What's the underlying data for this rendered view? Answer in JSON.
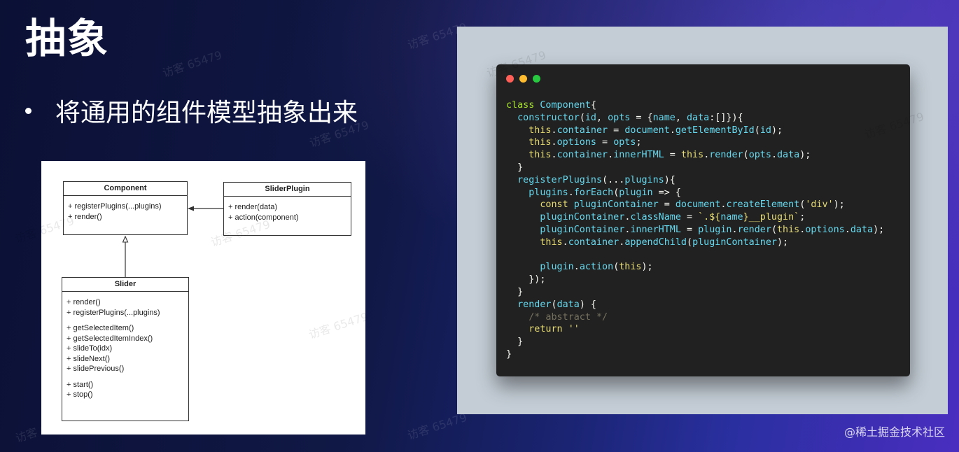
{
  "slide": {
    "title": "抽象",
    "bullet": "将通用的组件模型抽象出来",
    "watermark": "访客 65479",
    "credit": "@稀土掘金技术社区"
  },
  "uml": {
    "component": {
      "name": "Component",
      "methods": [
        "+ registerPlugins(...plugins)",
        "+ render()"
      ]
    },
    "slider_plugin": {
      "name": "SliderPlugin",
      "methods": [
        "+ render(data)",
        "+ action(component)"
      ]
    },
    "slider": {
      "name": "Slider",
      "groups": [
        [
          "+ render()",
          "+ registerPlugins(...plugins)"
        ],
        [
          "+ getSelectedItem()",
          "+ getSelectedItemIndex()",
          "+ slideTo(idx)",
          "+ slideNext()",
          "+ slidePrevious()"
        ],
        [
          "+ start()",
          "+ stop()"
        ]
      ]
    }
  },
  "code_window": {
    "dot_colors": [
      "#ff5f57",
      "#febc2e",
      "#28c840"
    ],
    "colors": {
      "keyword": "#a6e22e",
      "name": "#66d9ef",
      "this": "#e6db74",
      "ident": "#f8f8f2",
      "string": "#e6db74",
      "comment": "#75715e",
      "plain": "#f8f8f2"
    },
    "lines": [
      [
        [
          "k",
          "class "
        ],
        [
          "n",
          "Component"
        ],
        [
          "p",
          "{"
        ]
      ],
      [
        [
          "p",
          "  "
        ],
        [
          "n",
          "constructor"
        ],
        [
          "p",
          "("
        ],
        [
          "n",
          "id"
        ],
        [
          "p",
          ", "
        ],
        [
          "n",
          "opts"
        ],
        [
          "p",
          " = {"
        ],
        [
          "n",
          "name"
        ],
        [
          "p",
          ", "
        ],
        [
          "n",
          "data"
        ],
        [
          "p",
          ":[]}){"
        ]
      ],
      [
        [
          "p",
          "    "
        ],
        [
          "t",
          "this"
        ],
        [
          "p",
          "."
        ],
        [
          "n",
          "container"
        ],
        [
          "p",
          " = "
        ],
        [
          "n",
          "document"
        ],
        [
          "p",
          "."
        ],
        [
          "n",
          "getElementById"
        ],
        [
          "p",
          "("
        ],
        [
          "n",
          "id"
        ],
        [
          "p",
          ");"
        ]
      ],
      [
        [
          "p",
          "    "
        ],
        [
          "t",
          "this"
        ],
        [
          "p",
          "."
        ],
        [
          "n",
          "options"
        ],
        [
          "p",
          " = "
        ],
        [
          "n",
          "opts"
        ],
        [
          "p",
          ";"
        ]
      ],
      [
        [
          "p",
          "    "
        ],
        [
          "t",
          "this"
        ],
        [
          "p",
          "."
        ],
        [
          "n",
          "container"
        ],
        [
          "p",
          "."
        ],
        [
          "n",
          "innerHTML"
        ],
        [
          "p",
          " = "
        ],
        [
          "t",
          "this"
        ],
        [
          "p",
          "."
        ],
        [
          "n",
          "render"
        ],
        [
          "p",
          "("
        ],
        [
          "n",
          "opts"
        ],
        [
          "p",
          "."
        ],
        [
          "n",
          "data"
        ],
        [
          "p",
          ");"
        ]
      ],
      [
        [
          "p",
          "  }"
        ]
      ],
      [
        [
          "p",
          "  "
        ],
        [
          "n",
          "registerPlugins"
        ],
        [
          "p",
          "(..."
        ],
        [
          "n",
          "plugins"
        ],
        [
          "p",
          "){"
        ]
      ],
      [
        [
          "p",
          "    "
        ],
        [
          "n",
          "plugins"
        ],
        [
          "p",
          "."
        ],
        [
          "n",
          "forEach"
        ],
        [
          "p",
          "("
        ],
        [
          "n",
          "plugin"
        ],
        [
          "p",
          " => {"
        ]
      ],
      [
        [
          "p",
          "      "
        ],
        [
          "t",
          "const "
        ],
        [
          "n",
          "pluginContainer"
        ],
        [
          "p",
          " = "
        ],
        [
          "n",
          "document"
        ],
        [
          "p",
          "."
        ],
        [
          "n",
          "createElement"
        ],
        [
          "p",
          "("
        ],
        [
          "s",
          "'div'"
        ],
        [
          "p",
          ");"
        ]
      ],
      [
        [
          "p",
          "      "
        ],
        [
          "n",
          "pluginContainer"
        ],
        [
          "p",
          "."
        ],
        [
          "n",
          "className"
        ],
        [
          "p",
          " = "
        ],
        [
          "s",
          "`.${"
        ],
        [
          "n",
          "name"
        ],
        [
          "s",
          "}__plugin`"
        ],
        [
          "p",
          ";"
        ]
      ],
      [
        [
          "p",
          "      "
        ],
        [
          "n",
          "pluginContainer"
        ],
        [
          "p",
          "."
        ],
        [
          "n",
          "innerHTML"
        ],
        [
          "p",
          " = "
        ],
        [
          "n",
          "plugin"
        ],
        [
          "p",
          "."
        ],
        [
          "n",
          "render"
        ],
        [
          "p",
          "("
        ],
        [
          "t",
          "this"
        ],
        [
          "p",
          "."
        ],
        [
          "n",
          "options"
        ],
        [
          "p",
          "."
        ],
        [
          "n",
          "data"
        ],
        [
          "p",
          ");"
        ]
      ],
      [
        [
          "p",
          "      "
        ],
        [
          "t",
          "this"
        ],
        [
          "p",
          "."
        ],
        [
          "n",
          "container"
        ],
        [
          "p",
          "."
        ],
        [
          "n",
          "appendChild"
        ],
        [
          "p",
          "("
        ],
        [
          "n",
          "pluginContainer"
        ],
        [
          "p",
          ");"
        ]
      ],
      [
        [
          "p",
          ""
        ]
      ],
      [
        [
          "p",
          "      "
        ],
        [
          "n",
          "plugin"
        ],
        [
          "p",
          "."
        ],
        [
          "n",
          "action"
        ],
        [
          "p",
          "("
        ],
        [
          "t",
          "this"
        ],
        [
          "p",
          ");"
        ]
      ],
      [
        [
          "p",
          "    });"
        ]
      ],
      [
        [
          "p",
          "  }"
        ]
      ],
      [
        [
          "p",
          "  "
        ],
        [
          "n",
          "render"
        ],
        [
          "p",
          "("
        ],
        [
          "n",
          "data"
        ],
        [
          "p",
          ") {"
        ]
      ],
      [
        [
          "p",
          "    "
        ],
        [
          "c",
          "/* abstract */"
        ]
      ],
      [
        [
          "p",
          "    "
        ],
        [
          "t",
          "return "
        ],
        [
          "s",
          "''"
        ]
      ],
      [
        [
          "p",
          "  }"
        ]
      ],
      [
        [
          "p",
          "}"
        ]
      ]
    ]
  }
}
